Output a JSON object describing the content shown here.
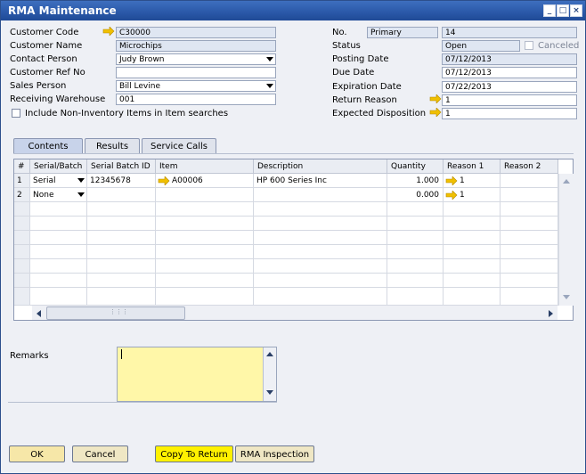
{
  "window": {
    "title": "RMA Maintenance"
  },
  "header_left": {
    "customer_code_label": "Customer Code",
    "customer_code": "C30000",
    "customer_name_label": "Customer Name",
    "customer_name": "Microchips",
    "contact_person_label": "Contact Person",
    "contact_person": "Judy Brown",
    "customer_ref_label": "Customer Ref No",
    "customer_ref": "",
    "sales_person_label": "Sales Person",
    "sales_person": "Bill Levine",
    "receiving_wh_label": "Receiving Warehouse",
    "receiving_wh": "001",
    "include_noninv_label": "Include Non-Inventory Items in Item searches"
  },
  "header_right": {
    "no_label": "No.",
    "series": "Primary",
    "number": "14",
    "status_label": "Status",
    "status": "Open",
    "canceled_label": "Canceled",
    "posting_date_label": "Posting Date",
    "posting_date": "07/12/2013",
    "due_date_label": "Due Date",
    "due_date": "07/12/2013",
    "expiration_date_label": "Expiration Date",
    "expiration_date": "07/22/2013",
    "return_reason_label": "Return Reason",
    "return_reason": "1",
    "expected_disposition_label": "Expected Disposition",
    "expected_disposition": "1"
  },
  "tabs": [
    "Contents",
    "Results",
    "Service Calls"
  ],
  "grid": {
    "columns": [
      "#",
      "Serial/Batch",
      "Serial Batch ID",
      "Item",
      "Description",
      "Quantity",
      "Reason 1",
      "Reason 2"
    ],
    "rows": [
      {
        "num": "1",
        "serial_batch": "Serial",
        "batch_id": "12345678",
        "item": "A00006",
        "description": "HP 600 Series Inc",
        "quantity": "1.000",
        "reason1": "1",
        "reason2": ""
      },
      {
        "num": "2",
        "serial_batch": "None",
        "batch_id": "",
        "item": "",
        "description": "",
        "quantity": "0.000",
        "reason1": "1",
        "reason2": ""
      }
    ]
  },
  "remarks": {
    "label": "Remarks",
    "value": ""
  },
  "buttons": {
    "ok": "OK",
    "cancel": "Cancel",
    "copy_to_return": "Copy To Return",
    "rma_inspection": "RMA Inspection"
  },
  "colors": {
    "title_bar": "#2a58a8",
    "link_arrow": "#f0c000",
    "remarks_bg": "#fff7a8",
    "highlight_button": "#fff100"
  }
}
